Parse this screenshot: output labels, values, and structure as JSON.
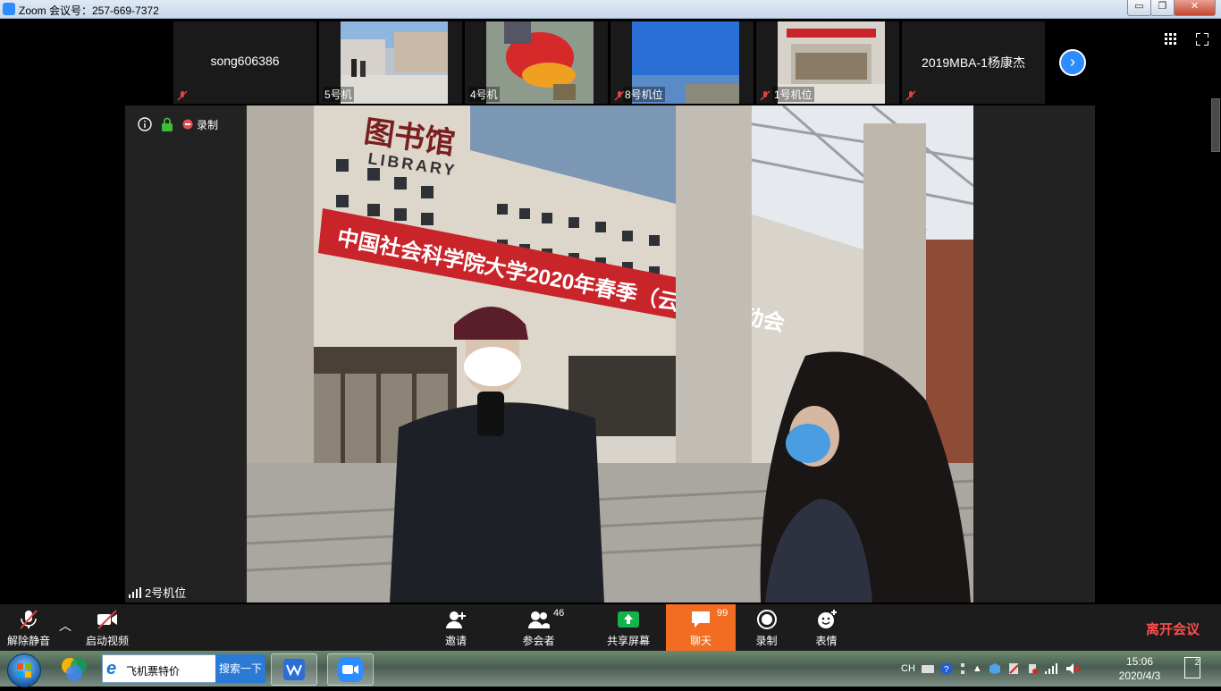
{
  "window": {
    "title": "Zoom 会议号：257-669-7372",
    "min": "▭",
    "max": "❐",
    "close": "✕"
  },
  "thumbnails": [
    {
      "name": "song606386",
      "muted": true
    },
    {
      "label": "5号机",
      "muted": false
    },
    {
      "label": "4号机",
      "muted": false
    },
    {
      "label": "8号机位",
      "muted": true
    },
    {
      "label": "1号机位",
      "muted": true
    },
    {
      "name": "2019MBA-1杨康杰",
      "muted": true
    }
  ],
  "next_icon": "›",
  "main": {
    "recording_label": "录制",
    "speaker_label": "2号机位",
    "library_sign_cn": "图书馆",
    "library_sign_en": "LIBRARY",
    "banner": "中国社会科学院大学2020年春季（云端）运动会"
  },
  "controls": {
    "unmute": "解除静音",
    "start_video": "启动视频",
    "invite": "邀请",
    "participants": "参会者",
    "participants_count": "46",
    "share": "共享屏幕",
    "chat": "聊天",
    "chat_count": "99",
    "record": "录制",
    "reactions": "表情",
    "leave": "离开会议",
    "chat_color": "#f26d21",
    "share_color": "#12b44c",
    "leave_color": "#ff4d4f"
  },
  "taskbar": {
    "search_query": "飞机票特价",
    "search_button": "搜索一下",
    "ime": "CH",
    "time": "15:06",
    "date": "2020/4/3",
    "notif_count": "2"
  }
}
